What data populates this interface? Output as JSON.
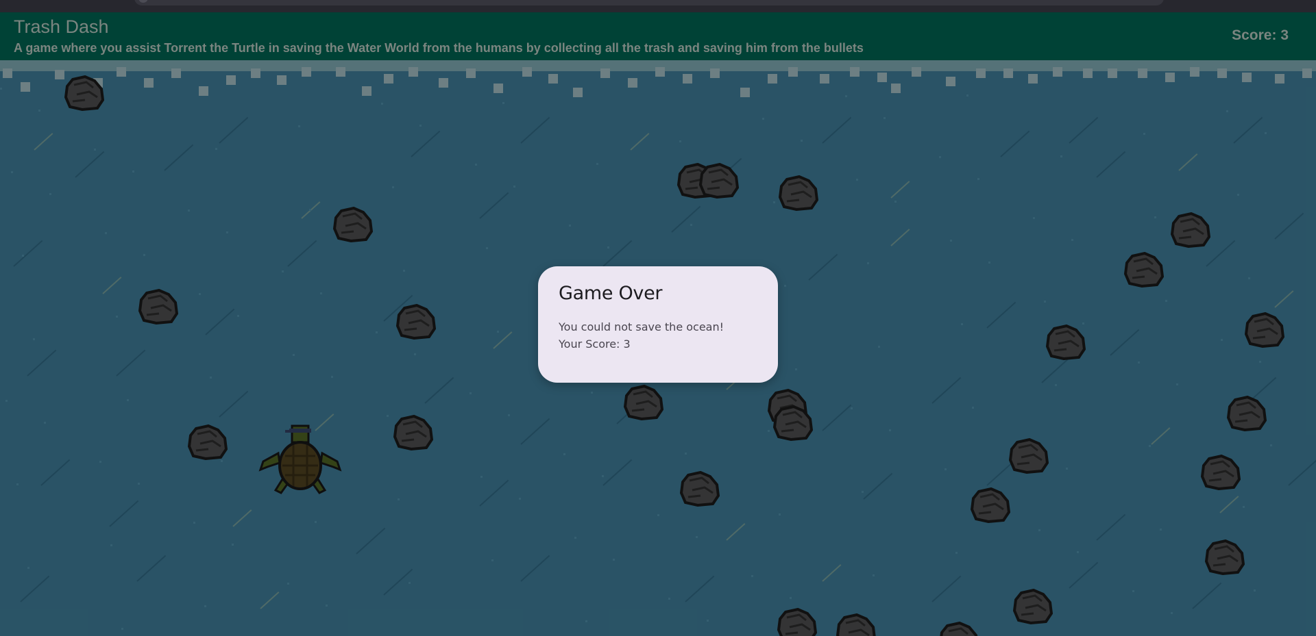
{
  "app": {
    "title": "Trash Dash",
    "subtitle": "A game where you assist Torrent the Turtle in saving the Water World from the humans by collecting all the trash and saving him from the bullets",
    "score_label": "Score: 3"
  },
  "dialog": {
    "title": "Game Over",
    "message": "You could not save the ocean!",
    "score_text": "Your Score: 3"
  },
  "colors": {
    "appbar": "#004a3d",
    "water": "#2f5d72",
    "dialog_bg": "#ece6f2"
  },
  "sprites": {
    "player": "turtle-icon",
    "obstacle": "trash-rock-icon"
  }
}
